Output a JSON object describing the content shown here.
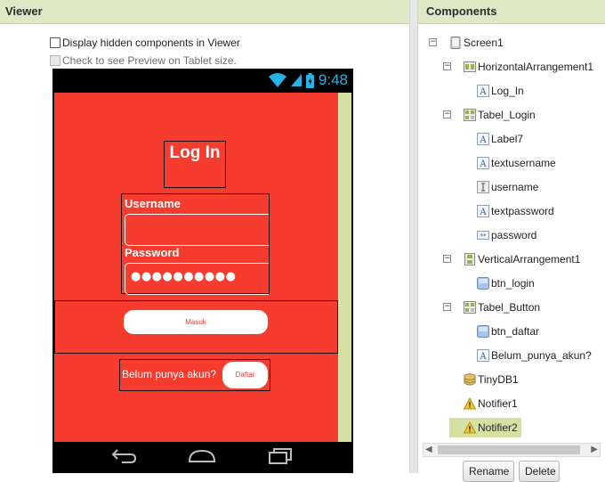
{
  "viewer": {
    "header": "Viewer",
    "options": {
      "display_hidden": "Display hidden components in Viewer",
      "tablet_preview": "Check to see Preview on Tablet size."
    }
  },
  "phone": {
    "status": {
      "time": "9:48"
    },
    "screen": {
      "title": "Log In",
      "username_label": "Username",
      "password_label": "Password",
      "password_value": "●●●●●●●●●●",
      "login_button": "Masuk",
      "register_text": "Belum punya akun?",
      "register_button": "Daftar"
    },
    "colors": {
      "screen_bg": "#f53c2f",
      "scroll_track": "#d4e1a3",
      "clock": "#26b3e5"
    }
  },
  "components": {
    "header": "Components",
    "tree": [
      {
        "label": "Screen1",
        "icon": "screen-icon",
        "level": 0,
        "toggle": "−"
      },
      {
        "label": "HorizontalArrangement1",
        "icon": "horizontal-arrangement-icon",
        "level": 1,
        "toggle": "−"
      },
      {
        "label": "Log_In",
        "icon": "label-icon",
        "level": 2
      },
      {
        "label": "Tabel_Login",
        "icon": "table-arrangement-icon",
        "level": 1,
        "toggle": "−"
      },
      {
        "label": "Label7",
        "icon": "label-icon",
        "level": 2
      },
      {
        "label": "textusername",
        "icon": "label-icon",
        "level": 2
      },
      {
        "label": "username",
        "icon": "textbox-icon",
        "level": 2
      },
      {
        "label": "textpassword",
        "icon": "label-icon",
        "level": 2
      },
      {
        "label": "password",
        "icon": "password-textbox-icon",
        "level": 2
      },
      {
        "label": "VerticalArrangement1",
        "icon": "vertical-arrangement-icon",
        "level": 1,
        "toggle": "−"
      },
      {
        "label": "btn_login",
        "icon": "button-icon",
        "level": 2
      },
      {
        "label": "Tabel_Button",
        "icon": "table-arrangement-icon",
        "level": 1,
        "toggle": "−"
      },
      {
        "label": "btn_daftar",
        "icon": "button-icon",
        "level": 2
      },
      {
        "label": "Belum_punya_akun?",
        "icon": "label-icon",
        "level": 2
      },
      {
        "label": "TinyDB1",
        "icon": "database-icon",
        "level": 1
      },
      {
        "label": "Notifier1",
        "icon": "warning-icon",
        "level": 1
      },
      {
        "label": "Notifier2",
        "icon": "warning-icon",
        "level": 1,
        "selected": true
      }
    ],
    "buttons": {
      "rename": "Rename",
      "delete": "Delete"
    }
  }
}
